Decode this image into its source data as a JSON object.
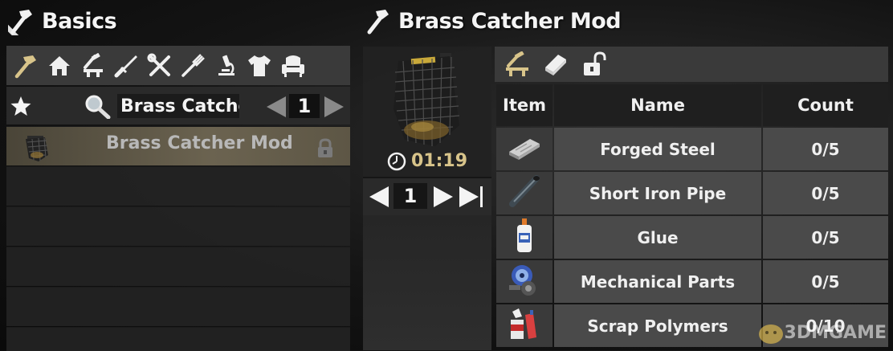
{
  "left": {
    "title": "Basics",
    "categories": [
      "basics-hammer-icon",
      "building-icon",
      "crafting-tools-icon",
      "weapon-knife-icon",
      "tools-wrench-screwdriver-icon",
      "food-fork-icon",
      "science-microscope-icon",
      "clothing-shirt-icon",
      "decor-armchair-icon"
    ],
    "search": {
      "value": "Brass Catcher"
    },
    "page": "1",
    "recipes": [
      {
        "name": "Brass Catcher Mod",
        "locked": true
      }
    ]
  },
  "right": {
    "title": "Brass Catcher Mod",
    "craft_time": "01:19",
    "quantity": "1",
    "toolbar": [
      "workbench-icon",
      "book-icon",
      "unlock-icon"
    ],
    "columns": {
      "item": "Item",
      "name": "Name",
      "count": "Count"
    },
    "ingredients": [
      {
        "name": "Forged Steel",
        "count": "0/5",
        "icon": "forged-steel-icon"
      },
      {
        "name": "Short Iron Pipe",
        "count": "0/5",
        "icon": "iron-pipe-icon"
      },
      {
        "name": "Glue",
        "count": "0/5",
        "icon": "glue-icon"
      },
      {
        "name": "Mechanical Parts",
        "count": "0/5",
        "icon": "mechanical-parts-icon"
      },
      {
        "name": "Scrap Polymers",
        "count": "0/10",
        "icon": "scrap-polymers-icon"
      }
    ]
  },
  "watermark": "3DMGAME",
  "colors": {
    "accent_gold": "#d8c48a",
    "panel": "#3a3a3a",
    "selected_row": "#6b6350"
  }
}
